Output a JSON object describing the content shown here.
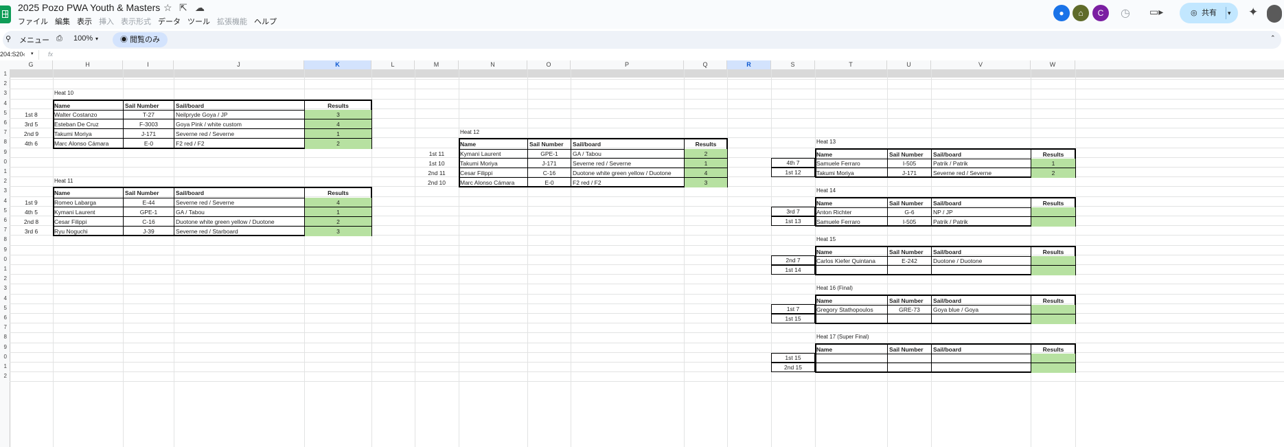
{
  "app": {
    "title": "2025 Pozo PWA Youth & Masters",
    "menu": [
      "ファイル",
      "編集",
      "表示",
      "挿入",
      "表示形式",
      "データ",
      "ツール",
      "拡張機能",
      "ヘルプ"
    ],
    "menu_disabled": [
      3,
      4,
      7
    ],
    "share_label": "共有",
    "user_initial": "C",
    "colors": {
      "accent": "#0f9d58",
      "share_bg": "#c2e7ff",
      "result_fill": "#b7e1a1",
      "selected_col": "#d3e3fd"
    }
  },
  "toolbar": {
    "menu_label": "メニュー",
    "zoom": "100%",
    "view_only": "閲覧のみ"
  },
  "formula_bar": {
    "cell_ref": "204:S20‹",
    "fx": "fx"
  },
  "columns": [
    "G",
    "H",
    "I",
    "J",
    "K",
    "L",
    "M",
    "N",
    "O",
    "P",
    "Q",
    "R",
    "S",
    "T",
    "U",
    "V",
    "W"
  ],
  "rows": [
    "1",
    "2",
    "3",
    "4",
    "5",
    "6",
    "7",
    "8",
    "9",
    "0",
    "1",
    "2",
    "3",
    "4",
    "5",
    "6",
    "7",
    "8",
    "9",
    "0",
    "1",
    "2",
    "3",
    "4",
    "5",
    "6",
    "7",
    "8",
    "9",
    "0",
    "1",
    "2"
  ],
  "headers": {
    "name": "Name",
    "sail_number": "Sail Number",
    "sail_board": "Sail/board",
    "results": "Results"
  },
  "heats": [
    {
      "title": "Heat 10",
      "rows": [
        {
          "pos": "1st 8",
          "name": "Walter Costanzo",
          "sail": "T-27",
          "board": "Neilpryde Goya / JP",
          "result": "3"
        },
        {
          "pos": "3rd 5",
          "name": "Esteban De Cruz",
          "sail": "F-3003",
          "board": "Goya Pink / white custom",
          "result": "4"
        },
        {
          "pos": "2nd 9",
          "name": "Takumi Moriya",
          "sail": "J-171",
          "board": "Severne red / Severne",
          "result": "1"
        },
        {
          "pos": "4th 6",
          "name": "Marc Alonso Cámara",
          "sail": "E-0",
          "board": "F2 red / F2",
          "result": "2"
        }
      ]
    },
    {
      "title": "Heat 11",
      "rows": [
        {
          "pos": "1st 9",
          "name": "Romeo Labarga",
          "sail": "E-44",
          "board": "Severne red / Severne",
          "result": "4"
        },
        {
          "pos": "4th 5",
          "name": "Kymani Laurent",
          "sail": "GPE-1",
          "board": "GA / Tabou",
          "result": "1"
        },
        {
          "pos": "2nd 8",
          "name": "Cesar Filippi",
          "sail": "C-16",
          "board": "Duotone white green yellow / Duotone",
          "result": "2"
        },
        {
          "pos": "3rd 6",
          "name": "Ryu Noguchi",
          "sail": "J-39",
          "board": "Severne red / Starboard",
          "result": "3"
        }
      ]
    },
    {
      "title": "Heat 12",
      "rows": [
        {
          "pos": "1st 11",
          "name": "Kymani Laurent",
          "sail": "GPE-1",
          "board": "GA / Tabou",
          "result": "2"
        },
        {
          "pos": "1st 10",
          "name": "Takumi Moriya",
          "sail": "J-171",
          "board": "Severne red / Severne",
          "result": "1"
        },
        {
          "pos": "2nd 11",
          "name": "Cesar Filippi",
          "sail": "C-16",
          "board": "Duotone white green yellow / Duotone",
          "result": "4"
        },
        {
          "pos": "2nd 10",
          "name": "Marc Alonso Cámara",
          "sail": "E-0",
          "board": "F2 red / F2",
          "result": "3"
        }
      ]
    },
    {
      "title": "Heat 13",
      "rows": [
        {
          "pos": "4th 7",
          "name": "Samuele Ferraro",
          "sail": "I-505",
          "board": "Patrik / Patrik",
          "result": "1"
        },
        {
          "pos": "1st 12",
          "name": "Takumi Moriya",
          "sail": "J-171",
          "board": "Severne red / Severne",
          "result": "2"
        }
      ]
    },
    {
      "title": "Heat 14",
      "rows": [
        {
          "pos": "3rd 7",
          "name": "Anton Richter",
          "sail": "G-6",
          "board": "NP / JP",
          "result": ""
        },
        {
          "pos": "1st 13",
          "name": "Samuele Ferraro",
          "sail": "I-505",
          "board": "Patrik / Patrik",
          "result": ""
        }
      ]
    },
    {
      "title": "Heat 15",
      "rows": [
        {
          "pos": "2nd 7",
          "name": "Carlos Kiefer Quintana",
          "sail": "E-242",
          "board": "Duotone  / Duotone",
          "result": ""
        },
        {
          "pos": "1st 14",
          "name": "",
          "sail": "",
          "board": "",
          "result": ""
        }
      ]
    },
    {
      "title": "Heat 16 (Final)",
      "rows": [
        {
          "pos": "1st 7",
          "name": "Gregory Stathopoulos",
          "sail": "GRE-73",
          "board": "Goya blue / Goya",
          "result": ""
        },
        {
          "pos": "1st 15",
          "name": "",
          "sail": "",
          "board": "",
          "result": ""
        }
      ]
    },
    {
      "title": "Heat 17 (Super Final)",
      "rows": [
        {
          "pos": "1st 15",
          "name": "",
          "sail": "",
          "board": "",
          "result": ""
        },
        {
          "pos": "2nd 15",
          "name": "",
          "sail": "",
          "board": "",
          "result": ""
        }
      ]
    }
  ]
}
